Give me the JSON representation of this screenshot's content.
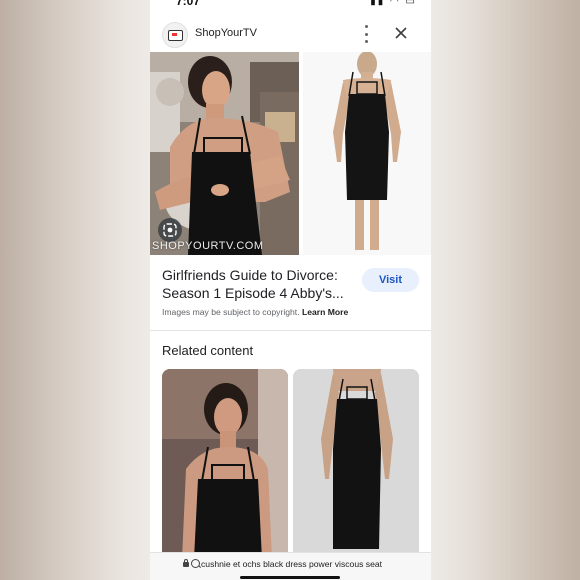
{
  "status_bar": {
    "time": "7:07"
  },
  "header": {
    "site_name": "ShopYourTV",
    "logo_icon": "tv-icon",
    "menu_icon": "more-vert-icon",
    "close_icon": "close-icon"
  },
  "result": {
    "watermark": "SHOPYOURTV.COM",
    "title": "Girlfriends Guide to Divorce: Season 1 Episode 4 Abby's...",
    "visit_label": "Visit",
    "copyright_text": "Images may be subject to copyright.",
    "learn_more": "Learn More"
  },
  "related": {
    "heading": "Related content"
  },
  "search_bar": {
    "query": "cushnie et ochs black dress power viscous seat"
  },
  "colors": {
    "accent": "#1a56c4",
    "visit_bg": "#e8f0fe",
    "text": "#202124",
    "muted": "#5f6368"
  }
}
